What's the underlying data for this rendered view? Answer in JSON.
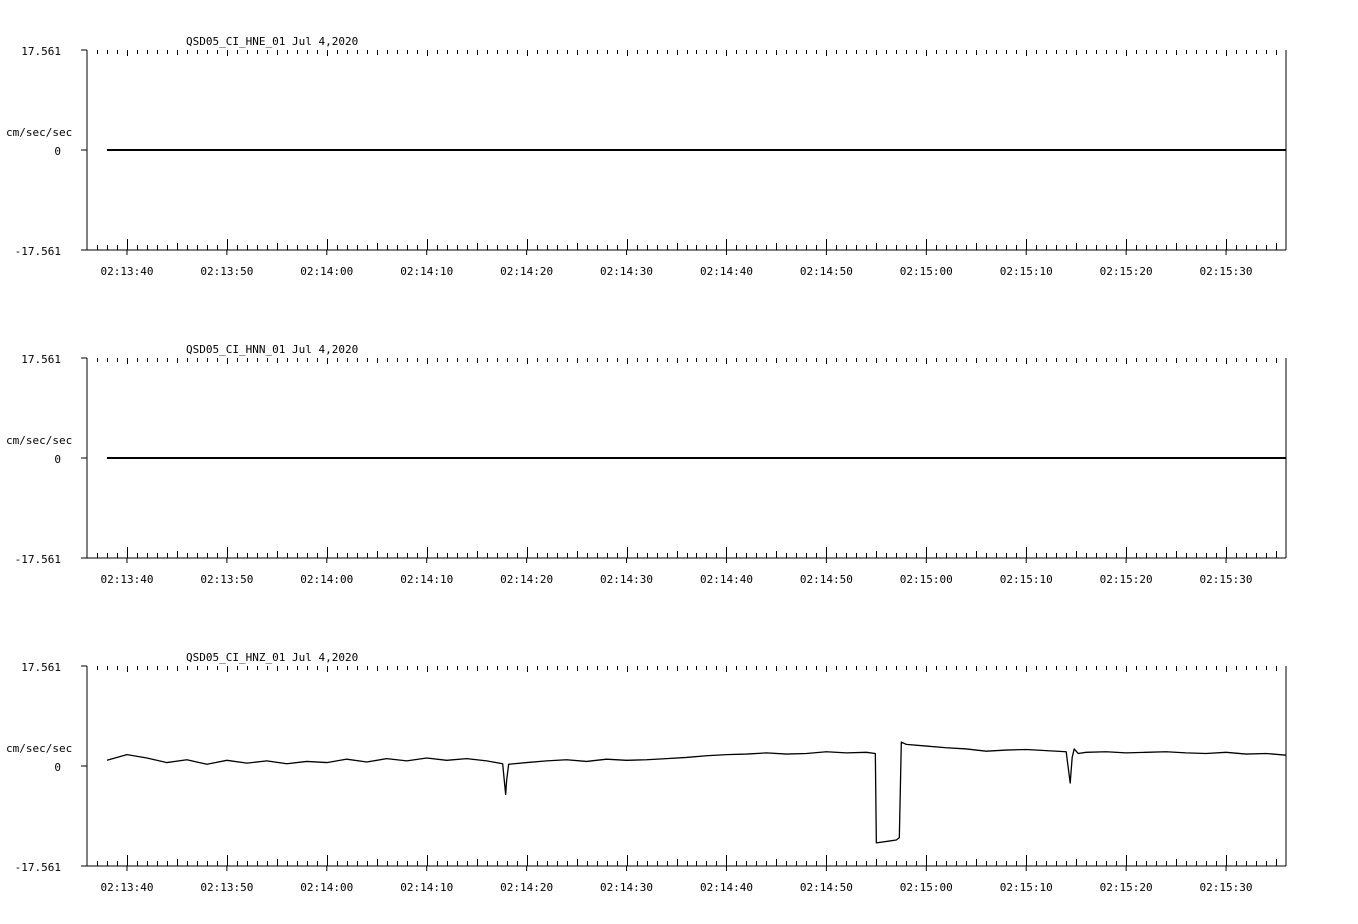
{
  "chart_data": [
    {
      "type": "line",
      "title": "QSD05_CI_HNE_01  Jul 4,2020",
      "ylabel": "cm/sec/sec",
      "ylim": [
        -17.561,
        17.561
      ],
      "yticks": [
        "17.561",
        "0",
        "-17.561"
      ],
      "x_start": "02:13:36",
      "x_end": "02:15:36",
      "xticks": [
        "02:13:40",
        "02:13:50",
        "02:14:00",
        "02:14:10",
        "02:14:20",
        "02:14:30",
        "02:14:40",
        "02:14:50",
        "02:15:00",
        "02:15:10",
        "02:15:20",
        "02:15:30"
      ],
      "grid": false,
      "series": [
        {
          "x": [
            "02:13:38",
            "02:15:36"
          ],
          "y": [
            0,
            0
          ]
        }
      ]
    },
    {
      "type": "line",
      "title": "QSD05_CI_HNN_01  Jul 4,2020",
      "ylabel": "cm/sec/sec",
      "ylim": [
        -17.561,
        17.561
      ],
      "yticks": [
        "17.561",
        "0",
        "-17.561"
      ],
      "x_start": "02:13:36",
      "x_end": "02:15:36",
      "xticks": [
        "02:13:40",
        "02:13:50",
        "02:14:00",
        "02:14:10",
        "02:14:20",
        "02:14:30",
        "02:14:40",
        "02:14:50",
        "02:15:00",
        "02:15:10",
        "02:15:20",
        "02:15:30"
      ],
      "grid": false,
      "series": [
        {
          "x": [
            "02:13:38",
            "02:15:36"
          ],
          "y": [
            0,
            0
          ]
        }
      ]
    },
    {
      "type": "line",
      "title": "QSD05_CI_HNZ_01  Jul 4,2020",
      "ylabel": "cm/sec/sec",
      "ylim": [
        -17.561,
        17.561
      ],
      "yticks": [
        "17.561",
        "0",
        "-17.561"
      ],
      "x_start": "02:13:36",
      "x_end": "02:15:36",
      "xticks": [
        "02:13:40",
        "02:13:50",
        "02:14:00",
        "02:14:10",
        "02:14:20",
        "02:14:30",
        "02:14:40",
        "02:14:50",
        "02:15:00",
        "02:15:10",
        "02:15:20",
        "02:15:30"
      ],
      "grid": false,
      "series": [
        {
          "x": [
            "02:13:38",
            "02:13:40",
            "02:13:42",
            "02:13:44",
            "02:13:46",
            "02:13:48",
            "02:13:50",
            "02:13:52",
            "02:13:54",
            "02:13:56",
            "02:13:58",
            "02:14:00",
            "02:14:02",
            "02:14:04",
            "02:14:06",
            "02:14:08",
            "02:14:10",
            "02:14:12",
            "02:14:14",
            "02:14:16",
            "02:14:17.6",
            "02:14:17.9",
            "02:14:18.0",
            "02:14:18.2",
            "02:14:20",
            "02:14:22",
            "02:14:24",
            "02:14:26",
            "02:14:28",
            "02:14:30",
            "02:14:32",
            "02:14:34",
            "02:14:36",
            "02:14:38",
            "02:14:40",
            "02:14:42",
            "02:14:44",
            "02:14:46",
            "02:14:48",
            "02:14:50",
            "02:14:52",
            "02:14:54",
            "02:14:54.9",
            "02:14:55.0",
            "02:14:57.0",
            "02:14:57.3",
            "02:14:57.5",
            "02:14:58",
            "02:15:00",
            "02:15:02",
            "02:15:04",
            "02:15:06",
            "02:15:08",
            "02:15:10",
            "02:15:12",
            "02:15:14",
            "02:15:14.4",
            "02:15:14.6",
            "02:15:14.8",
            "02:15:15.2",
            "02:15:16",
            "02:15:18",
            "02:15:20",
            "02:15:22",
            "02:15:24",
            "02:15:26",
            "02:15:28",
            "02:15:30",
            "02:15:32",
            "02:15:34",
            "02:15:36"
          ],
          "y": [
            1.0,
            2.0,
            1.4,
            0.6,
            1.1,
            0.3,
            1.0,
            0.5,
            0.9,
            0.4,
            0.8,
            0.6,
            1.2,
            0.7,
            1.3,
            0.9,
            1.4,
            1.0,
            1.3,
            0.9,
            0.4,
            -5.0,
            -2.5,
            0.3,
            0.6,
            0.9,
            1.1,
            0.8,
            1.2,
            1.0,
            1.1,
            1.3,
            1.5,
            1.8,
            2.0,
            2.1,
            2.3,
            2.1,
            2.2,
            2.5,
            2.3,
            2.4,
            2.2,
            -13.5,
            -13.0,
            -12.6,
            4.2,
            3.8,
            3.5,
            3.2,
            3.0,
            2.6,
            2.8,
            2.9,
            2.7,
            2.5,
            -3.0,
            1.5,
            3.0,
            2.2,
            2.4,
            2.5,
            2.3,
            2.4,
            2.5,
            2.3,
            2.2,
            2.4,
            2.1,
            2.2,
            1.9
          ]
        }
      ]
    }
  ]
}
